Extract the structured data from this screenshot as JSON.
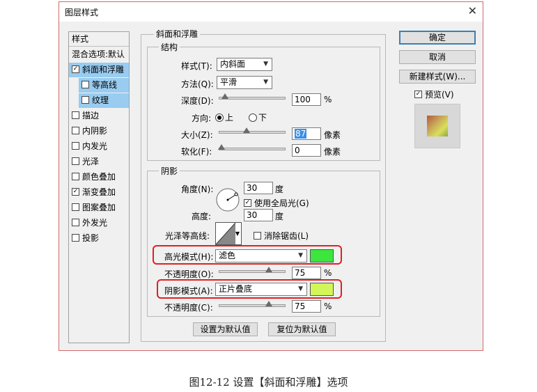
{
  "window": {
    "title": "图层样式",
    "close_glyph": "✕"
  },
  "left_panel": {
    "header": "样式",
    "blend": "混合选项:默认",
    "items": [
      {
        "label": "斜面和浮雕",
        "checked": true,
        "selected": true
      },
      {
        "label": "等高线",
        "checked": false,
        "sub": true
      },
      {
        "label": "纹理",
        "checked": false,
        "sub": true
      },
      {
        "label": "描边",
        "checked": false
      },
      {
        "label": "内阴影",
        "checked": false
      },
      {
        "label": "内发光",
        "checked": false
      },
      {
        "label": "光泽",
        "checked": false
      },
      {
        "label": "颜色叠加",
        "checked": false
      },
      {
        "label": "渐变叠加",
        "checked": true
      },
      {
        "label": "图案叠加",
        "checked": false
      },
      {
        "label": "外发光",
        "checked": false
      },
      {
        "label": "投影",
        "checked": false
      }
    ]
  },
  "bevel": {
    "section_title": "斜面和浮雕",
    "structure_title": "结构",
    "style_label": "样式(T):",
    "style_value": "内斜面",
    "method_label": "方法(Q):",
    "method_value": "平滑",
    "depth_label": "深度(D):",
    "depth_value": "100",
    "depth_unit": "%",
    "direction_label": "方向:",
    "dir_up": "上",
    "dir_down": "下",
    "size_label": "大小(Z):",
    "size_value": "87",
    "size_unit": "像素",
    "soften_label": "软化(F):",
    "soften_value": "0",
    "soften_unit": "像素"
  },
  "shading": {
    "title": "阴影",
    "angle_label": "角度(N):",
    "angle_value": "30",
    "angle_unit": "度",
    "global_light_label": "使用全局光(G)",
    "global_light_checked": true,
    "altitude_label": "高度:",
    "altitude_value": "30",
    "altitude_unit": "度",
    "gloss_label": "光泽等高线:",
    "antialias_label": "消除锯齿(L)",
    "highlight_label": "高光模式(H):",
    "highlight_value": "滤色",
    "highlight_color": "#3ce63c",
    "highlight_opacity_label": "不透明度(O):",
    "highlight_opacity_value": "75",
    "highlight_opacity_unit": "%",
    "shadow_label": "阴影模式(A):",
    "shadow_value": "正片叠底",
    "shadow_color": "#d2f55a",
    "shadow_opacity_label": "不透明度(C):",
    "shadow_opacity_value": "75",
    "shadow_opacity_unit": "%"
  },
  "footer_buttons": {
    "set_default": "设置为默认值",
    "reset_default": "复位为默认值"
  },
  "right_panel": {
    "ok": "确定",
    "cancel": "取消",
    "new_style": "新建样式(W)...",
    "preview_label": "预览(V)",
    "preview_checked": true
  },
  "caption": "图12-12  设置【斜面和浮雕】选项"
}
